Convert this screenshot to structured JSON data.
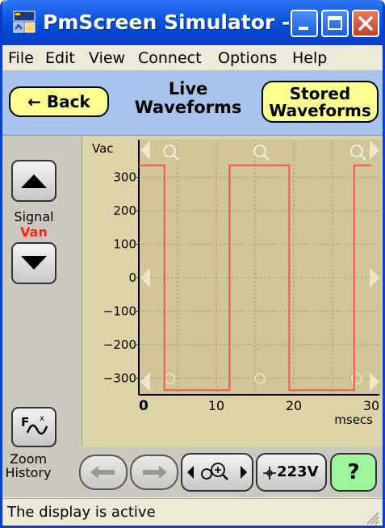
{
  "window": {
    "title": "PmScreen Simulator -..."
  },
  "menu": {
    "items": [
      "File",
      "Edit",
      "View",
      "Connect",
      "Options",
      "Help"
    ]
  },
  "nav": {
    "back_label": "Back",
    "title_line1": "Live",
    "title_line2": "Waveforms",
    "stored_line1": "Stored",
    "stored_line2": "Waveforms"
  },
  "signal": {
    "label": "Signal",
    "name": "Van",
    "name_color": "#ff2020"
  },
  "controls": {
    "zoom_history_line1": "Zoom",
    "zoom_history_line2": "History",
    "scale_label": "223V",
    "help_label": "?"
  },
  "status": {
    "text": "The display is active"
  },
  "colors": {
    "plot_bg": "#dcd4a6",
    "trace": "#ff5050",
    "nav_bg": "#a9c4ec",
    "yellow_btn": "#fdff90",
    "help_btn": "#9bf59b"
  },
  "icons": [
    "app-icon",
    "minimize-icon",
    "maximize-icon",
    "close-icon",
    "back-arrow-icon",
    "up-arrow-icon",
    "down-arrow-icon",
    "function-icon",
    "history-back-icon",
    "history-forward-icon",
    "zoom-pan-icon",
    "crosshair-icon",
    "zoom-in-icon",
    "zoom-out-icon",
    "pan-left-icon",
    "pan-right-icon",
    "resize-grip-icon"
  ],
  "chart_data": {
    "type": "line",
    "title": "",
    "xlabel": "msecs",
    "ylabel": "Vac",
    "xlim": [
      0,
      30
    ],
    "ylim": [
      -350,
      350
    ],
    "x_ticks": [
      0,
      10,
      20,
      30
    ],
    "y_ticks": [
      300,
      200,
      100,
      0,
      -100,
      -200,
      -300
    ],
    "y_tick_labels": [
      "300",
      "200",
      "100",
      "0",
      "−100",
      "−200",
      "−300"
    ],
    "grid": true,
    "series": [
      {
        "x": [
          0,
          3.3,
          3.3,
          11.7,
          11.7,
          19.4,
          19.4,
          27.8,
          27.8,
          30
        ],
        "y": [
          336,
          336,
          -336,
          -336,
          336,
          336,
          -336,
          -336,
          336,
          336
        ]
      }
    ]
  }
}
